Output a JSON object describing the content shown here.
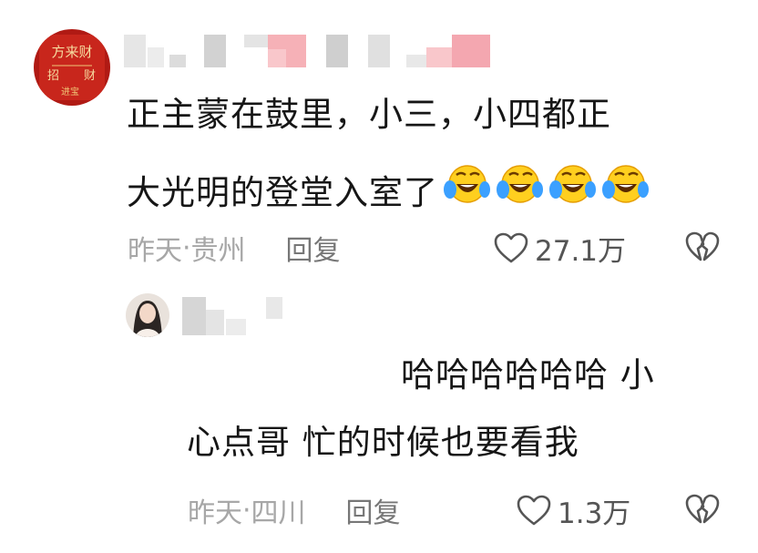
{
  "comments": [
    {
      "content_line1": "正主蒙在鼓里，小三，小四都正",
      "content_line2": "大光明的登堂入室了",
      "emoji": "laughing-crying-face",
      "emoji_count": 4,
      "time": "昨天",
      "separator": " · ",
      "location": "贵州",
      "reply_label": "回复",
      "likes": "27.1万",
      "avatar_text": "方来财"
    },
    {
      "content_line1": "哈哈哈哈哈哈 小",
      "content_line2": "心点哥 忙的时候也要看我",
      "time": "昨天",
      "separator": " · ",
      "location": "四川",
      "reply_label": "回复",
      "likes": "1.3万"
    }
  ],
  "colors": {
    "text": "#161616",
    "meta": "#a7a7a7",
    "reply": "#777777",
    "blur_pink": "#f4a7b0"
  }
}
